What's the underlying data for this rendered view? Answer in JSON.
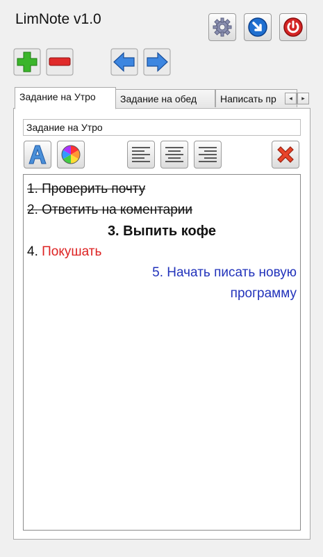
{
  "app": {
    "title": "LimNote v1.0"
  },
  "toolbar": {
    "settings_icon": "gear-icon",
    "minimize_icon": "arrow-down-right-icon",
    "power_icon": "power-icon",
    "add_icon": "plus-icon",
    "remove_icon": "minus-icon",
    "prev_icon": "arrow-left-icon",
    "next_icon": "arrow-right-icon"
  },
  "tabs": [
    {
      "label": "Задание на Утро",
      "active": true
    },
    {
      "label": "Задание на обед",
      "active": false
    },
    {
      "label": "Написать пр",
      "active": false
    }
  ],
  "note": {
    "title_value": "Задание на Утро",
    "lines": {
      "l1_num": "1.",
      "l1_text": " Проверить почту",
      "l2_num": "2.",
      "l2_text": " Ответить на коментарии",
      "l3": "3. Выпить кофе",
      "l4_num": "4.",
      "l4_text": " Покушать",
      "l5": "5. Начать писать новую программу"
    }
  },
  "colors": {
    "red_text": "#dd2222",
    "blue_text": "#2233bb"
  }
}
